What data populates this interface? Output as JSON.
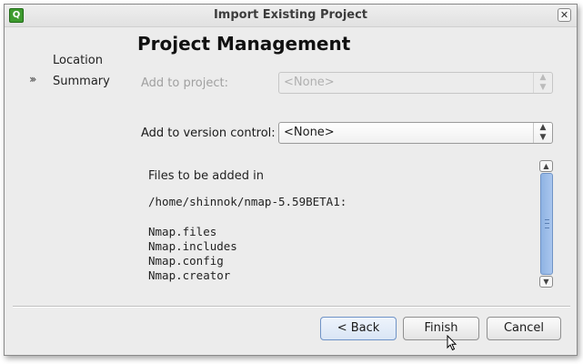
{
  "window": {
    "title": "Import Existing Project",
    "app_icon_glyph": "Q",
    "close_glyph": "✕"
  },
  "nav": {
    "items": [
      {
        "label": "Location"
      },
      {
        "label": "Summary"
      }
    ],
    "current_marker": "›››"
  },
  "page": {
    "title": "Project Management"
  },
  "add_to_project": {
    "label": "Add to project:",
    "value": "<None>"
  },
  "add_to_vcs": {
    "label": "Add to version control:",
    "value": "<None>"
  },
  "files": {
    "heading": "Files to be added in",
    "path": "/home/shinnok/nmap-5.59BETA1:",
    "list": [
      "Nmap.files",
      "Nmap.includes",
      "Nmap.config",
      "Nmap.creator"
    ]
  },
  "buttons": {
    "back": "< Back",
    "finish": "Finish",
    "cancel": "Cancel"
  },
  "colors": {
    "accent": "#6f93c6",
    "window_bg": "#ececec"
  }
}
